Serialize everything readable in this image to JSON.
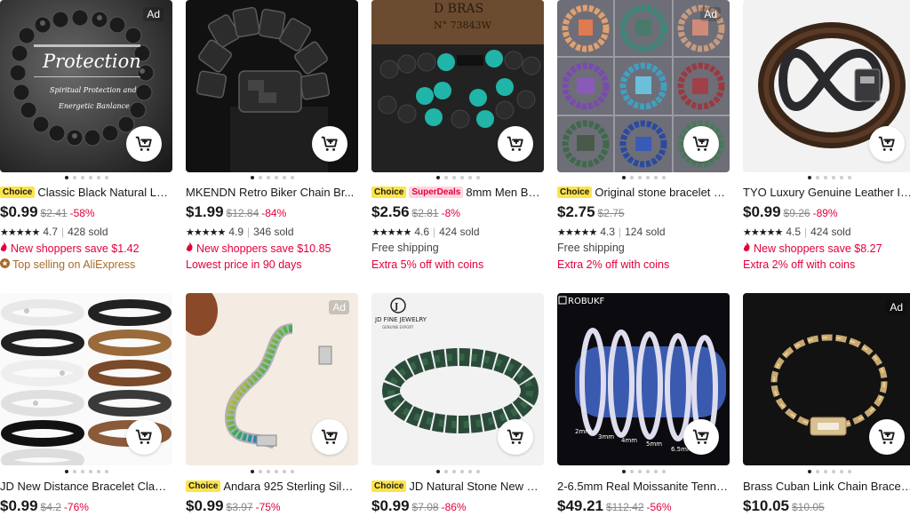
{
  "products": [
    {
      "title": "Classic Black Natural Lab...",
      "badges": [
        "Choice"
      ],
      "price": "$0.99",
      "old_price": "$2.41",
      "discount": "-58%",
      "rating": "4.7",
      "sold": "428 sold",
      "line4": "New shoppers save $1.42",
      "line4_style": "red-flame",
      "line5": "Top selling on AliExpress",
      "line5_style": "orange-icon",
      "ad": "Ad",
      "image_text": {
        "title": "Protection",
        "sub1": "Spiritual Protection and",
        "sub2": "Energetic Banlance"
      }
    },
    {
      "title": "MKENDN Retro Biker Chain Br...",
      "badges": [],
      "price": "$1.99",
      "old_price": "$12.84",
      "discount": "-84%",
      "rating": "4.9",
      "sold": "346 sold",
      "line4": "New shoppers save $10.85",
      "line4_style": "red-flame",
      "line5": "Lowest price in 90 days",
      "line5_style": "red"
    },
    {
      "title": "8mm Men Brac...",
      "badges": [
        "Choice",
        "SuperDeals"
      ],
      "price": "$2.56",
      "old_price": "$2.81",
      "discount": "-8%",
      "rating": "4.6",
      "sold": "424 sold",
      "line4": "Free shipping",
      "line4_style": "gray",
      "line5": "Extra 5% off with coins",
      "line5_style": "red",
      "image_text": {
        "stamp1": "D BRAS",
        "stamp2": "N° 73843W"
      }
    },
    {
      "title": "Original stone bracelet fo...",
      "badges": [
        "Choice"
      ],
      "price": "$2.75",
      "old_price": "$2.75",
      "discount": "",
      "rating": "4.3",
      "sold": "124 sold",
      "line4": "Free shipping",
      "line4_style": "gray",
      "line5": "Extra 2% off with coins",
      "line5_style": "red",
      "ad": "Ad"
    },
    {
      "title": "TYO Luxury Genuine Leather In...",
      "badges": [],
      "price": "$0.99",
      "old_price": "$9.26",
      "discount": "-89%",
      "rating": "4.5",
      "sold": "424 sold",
      "line4": "New shoppers save $8.27",
      "line4_style": "red-flame",
      "line5": "Extra 2% off with coins",
      "line5_style": "red"
    },
    {
      "title": "JD New Distance Bracelet Class...",
      "badges": [],
      "price": "$0.99",
      "old_price": "$4.2",
      "discount": "-76%"
    },
    {
      "title": "Andara 925 Sterling Silve...",
      "badges": [
        "Choice"
      ],
      "price": "$0.99",
      "old_price": "$3.97",
      "discount": "-75%",
      "ad": "Ad"
    },
    {
      "title": "JD Natural Stone New M...",
      "badges": [
        "Choice"
      ],
      "price": "$0.99",
      "old_price": "$7.08",
      "discount": "-86%",
      "image_text": {
        "logo": "JD FINE JEWELRY",
        "logo_sub": "GENUINE EXPORT"
      }
    },
    {
      "title": "2-6.5mm Real Moissanite Tenni...",
      "badges": [],
      "price": "$49.21",
      "old_price": "$112.42",
      "discount": "-56%",
      "image_text": {
        "brand": "ROBUKF",
        "s1": "2mm",
        "s2": "3mm",
        "s3": "4mm",
        "s4": "5mm",
        "s5": "6.5mm"
      }
    },
    {
      "title": "Brass Cuban Link Chain Bracele...",
      "badges": [],
      "price": "$10.05",
      "old_price": "$10.05",
      "discount": "",
      "ad": "Ad"
    }
  ],
  "icons": {
    "cart": "add-to-cart-icon",
    "flame": "flame-icon",
    "star": "star-icon"
  },
  "colors": {
    "discount_red": "#e1003c",
    "choice_yellow": "#fde44a",
    "superdeals_pink": "#ffd6e0",
    "top_selling_orange": "#a86a28"
  }
}
